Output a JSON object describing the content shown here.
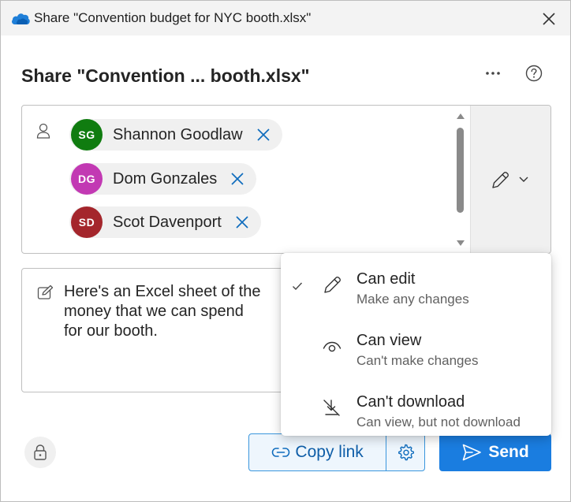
{
  "window": {
    "title": "Share \"Convention budget for NYC booth.xlsx\""
  },
  "dialog": {
    "heading": "Share \"Convention ... booth.xlsx\""
  },
  "recipients": [
    {
      "initials": "SG",
      "name": "Shannon Goodlaw",
      "color": "#107c10"
    },
    {
      "initials": "DG",
      "name": "Dom Gonzales",
      "color": "#c239b3"
    },
    {
      "initials": "SD",
      "name": "Scot Davenport",
      "color": "#a4262c"
    }
  ],
  "message": {
    "text": "Here's an Excel sheet of the money that we can spend for our booth."
  },
  "permission_menu": {
    "options": [
      {
        "label": "Can edit",
        "description": "Make any changes",
        "icon": "pencil-icon",
        "selected": true
      },
      {
        "label": "Can view",
        "description": "Can't make changes",
        "icon": "eye-icon",
        "selected": false
      },
      {
        "label": "Can't download",
        "description": "Can view, but not download",
        "icon": "no-download-icon",
        "selected": false
      }
    ]
  },
  "footer": {
    "copy_link_label": "Copy link",
    "send_label": "Send"
  },
  "colors": {
    "accent": "#1a7de0",
    "link": "#0f6cbd"
  }
}
